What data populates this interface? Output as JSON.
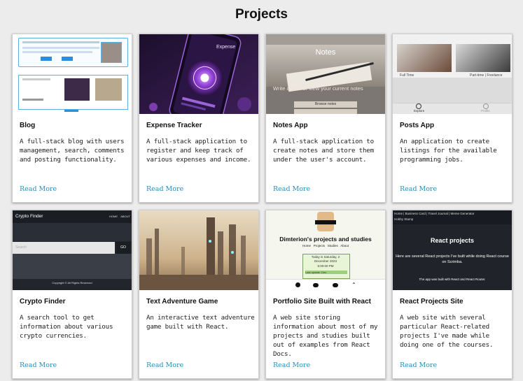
{
  "page": {
    "title": "Projects",
    "link_color": "#2a8db8"
  },
  "cards": [
    {
      "title": "Blog",
      "description": "A full-stack blog with users management, search, comments and posting functionality.",
      "link": "Read More"
    },
    {
      "title": "Expense Tracker",
      "description": "A full-stack application to register and keep track of various expenses and income.",
      "link": "Read More",
      "thumb": {
        "heading": "Expense"
      }
    },
    {
      "title": "Notes App",
      "description": "A full-stack application to create notes and store them under the user's account.",
      "link": "Read More",
      "thumb": {
        "heading": "Notes",
        "subheading": "Write a note or view your current notes",
        "button": "Browse notes"
      }
    },
    {
      "title": "Posts App",
      "description": "An application to create listings for the available programming jobs.",
      "link": "Read More",
      "thumb": {
        "label_left": "Full Time",
        "label_right": "Part-time | Freelance",
        "nav_left": "Explore",
        "nav_right": "Profile"
      }
    },
    {
      "title": "Crypto Finder",
      "description": "A search tool to get information about various crypto currencies.",
      "link": "Read More",
      "thumb": {
        "brand": "Crypto Finder",
        "nav": "HOME    ABOUT",
        "placeholder": "Search",
        "button": "GO",
        "footer": "Copyright © All Rights Reserved"
      }
    },
    {
      "title": "Text Adventure Game",
      "description": "An interactive text adventure game built with React.",
      "link": "Read More"
    },
    {
      "title": "Portfolio Site Built with React",
      "description": "A web site storing information about most of my projects and studies built out of examples from React Docs.",
      "link": "Read More",
      "thumb": {
        "heading": "Dimterion's projects and studies",
        "nav": "Home   Projects   Studies   About",
        "date_line1": "Today is Saturday, 2",
        "date_line2": "December 2023",
        "time": "5:00:00 PM",
        "note": "Last update: Dec"
      }
    },
    {
      "title": "React Projects Site",
      "description": "A web site with several particular React-related projects I've made while doing one of the courses.",
      "link": "Read More",
      "thumb": {
        "topnav": "Home | Business Card | Travel Journal | Meme Generator",
        "topnav2": "Hobby Stamp",
        "heading": "React projects",
        "sub": "Here are several React projects I've built while doing React course on Scrimba.",
        "foot": "The app was built with React and React Router."
      }
    }
  ]
}
